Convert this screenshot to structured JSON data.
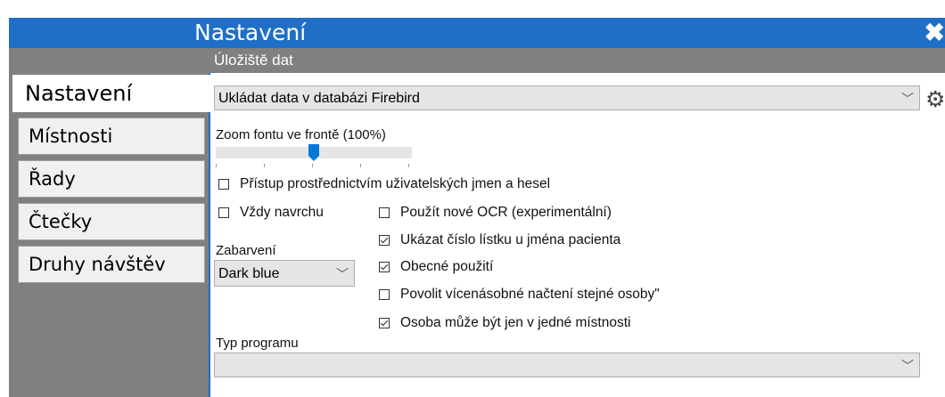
{
  "window": {
    "title": "Nastavení",
    "close_icon": "close-icon"
  },
  "section": {
    "title": "Úložiště dat"
  },
  "tabs": [
    {
      "label": "Nastavení",
      "active": true
    },
    {
      "label": "Místnosti"
    },
    {
      "label": "Řady"
    },
    {
      "label": "Čtečky"
    },
    {
      "label": "Druhy návštěv"
    }
  ],
  "storage": {
    "selected": "Ukládat data v databázi Firebird",
    "settings_icon": "gear-icon"
  },
  "zoom": {
    "label": "Zoom fontu ve frontě (100%)",
    "value_percent": 100
  },
  "options": {
    "login_access": {
      "label": "Přístup prostřednictvím uživatelských jmen a hesel",
      "checked": false
    },
    "always_on_top": {
      "label": "Vždy navrchu",
      "checked": false
    },
    "new_ocr": {
      "label": "Použít nové OCR (experimentální)",
      "checked": false
    },
    "show_ticket_number": {
      "label": "Ukázat číslo lístku u jména pacienta",
      "checked": true
    },
    "general_use": {
      "label": "Obecné použití",
      "checked": true
    },
    "multiple_load": {
      "label": "Povolit vícenásobné načtení stejné osoby\"",
      "checked": false
    },
    "one_room_only": {
      "label": "Osoba může být jen v jedné místnosti",
      "checked": true
    }
  },
  "coloring": {
    "label": "Zabarvení",
    "selected": "Dark blue"
  },
  "program_type": {
    "label": "Typ programu",
    "selected": ""
  },
  "colors": {
    "accent": "#1f6fc6",
    "panel": "#808080",
    "slider_thumb": "#0078d7"
  }
}
